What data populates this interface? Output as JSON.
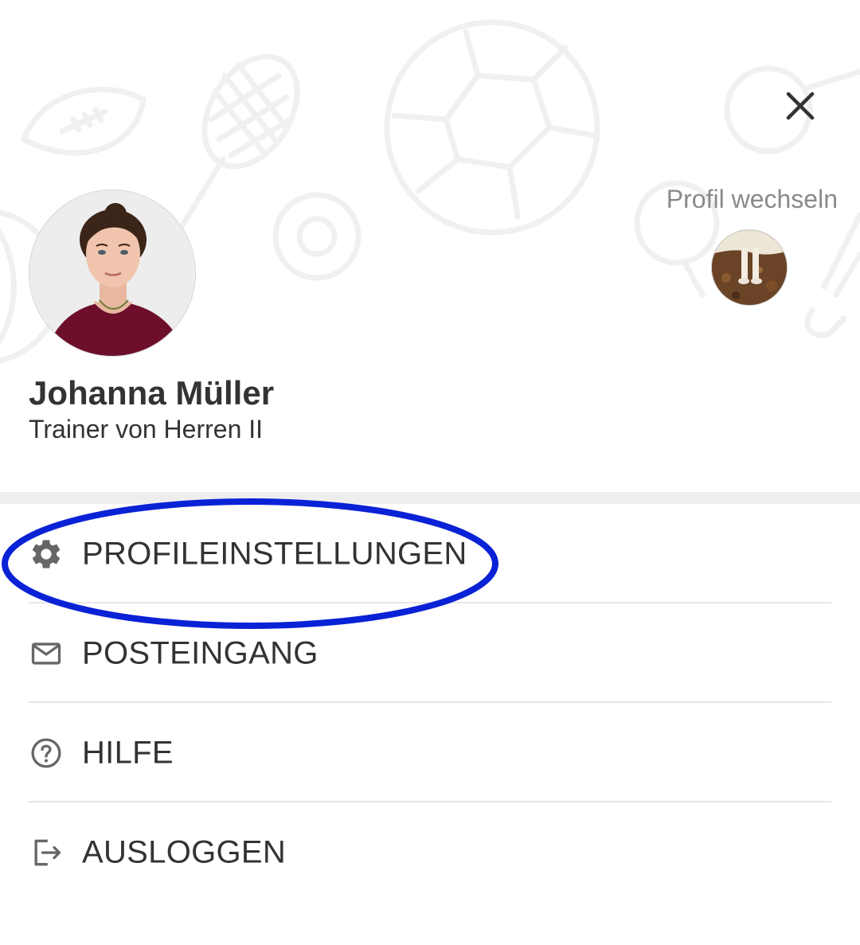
{
  "header": {
    "close_icon": "close-icon",
    "switch_profile_label": "Profil wechseln"
  },
  "profile": {
    "name": "Johanna Müller",
    "role": "Trainer von Herren II"
  },
  "menu": {
    "items": [
      {
        "label": "PROFILEINSTELLUNGEN",
        "icon": "gear-icon"
      },
      {
        "label": "POSTEINGANG",
        "icon": "mail-icon"
      },
      {
        "label": "HILFE",
        "icon": "help-icon"
      },
      {
        "label": "AUSLOGGEN",
        "icon": "logout-icon"
      }
    ]
  },
  "colors": {
    "text": "#333333",
    "muted": "#8a8a8a",
    "icon": "#666666",
    "highlight": "#0a22d6",
    "divider": "#eeeeee"
  }
}
